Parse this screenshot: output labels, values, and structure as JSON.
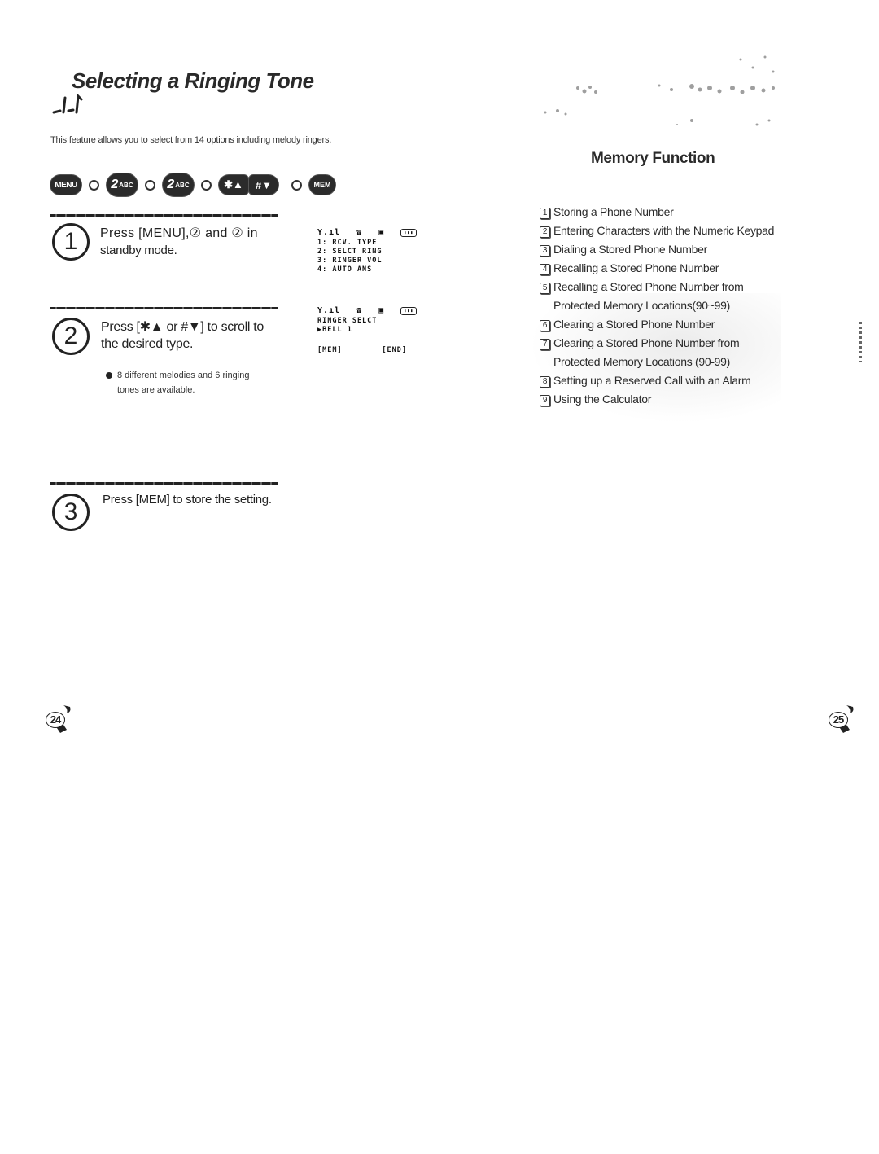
{
  "left_page": {
    "title": "Selecting a Ringing Tone",
    "intro": "This feature allows you to select from 14 options including melody ringers.",
    "key_sequence": [
      {
        "icon": "menu-key-icon",
        "label": "MENU"
      },
      {
        "icon": "two-abc-key-icon",
        "label": "2",
        "sub": "ABC"
      },
      {
        "icon": "two-abc-key-icon",
        "label": "2",
        "sub": "ABC"
      },
      {
        "icon": "star-up-key-icon",
        "label": "✱▲"
      },
      {
        "icon": "hash-down-key-icon",
        "label": "#▼"
      },
      {
        "icon": "mem-key-icon",
        "label": "MEM"
      }
    ],
    "steps": [
      {
        "number": "1",
        "text_line1": "Press [MENU],② and ② in",
        "text_line2": "standby mode.",
        "display": {
          "icons": [
            "signal-icon",
            "phone-icon",
            "d-icon",
            "battery-icon"
          ],
          "lines": [
            "1: RCV. TYPE",
            "2: SELCT RING",
            "3: RINGER VOL",
            "4: AUTO ANS"
          ]
        }
      },
      {
        "number": "2",
        "text_line1": "Press [✱▲ or #▼] to scroll to",
        "text_line2": "the desired type.",
        "note_line1": "8 different melodies and 6 ringing",
        "note_line2": "tones are available.",
        "display": {
          "icons": [
            "signal-icon",
            "phone-icon",
            "d-icon",
            "battery-icon"
          ],
          "lines": [
            "RINGER SELCT",
            "▶BELL 1"
          ],
          "softkey_left": "[MEM]",
          "softkey_right": "[END]"
        }
      },
      {
        "number": "3",
        "text_line1": "Press [MEM] to store the setting."
      }
    ],
    "page_number": "24"
  },
  "right_page": {
    "section_title": "Memory Function",
    "toc": [
      {
        "num": "1",
        "line1": "Storing a Phone Number"
      },
      {
        "num": "2",
        "line1": "Entering Characters with the Numeric Keypad"
      },
      {
        "num": "3",
        "line1": "Dialing a Stored Phone Number"
      },
      {
        "num": "4",
        "line1": "Recalling a Stored Phone Number"
      },
      {
        "num": "5",
        "line1": "Recalling a Stored Phone Number from",
        "line2": "Protected Memory Locations(90~99)"
      },
      {
        "num": "6",
        "line1": "Clearing a Stored Phone Number"
      },
      {
        "num": "7",
        "line1": "Clearing a Stored Phone Number from",
        "line2": "Protected Memory Locations (90-99)"
      },
      {
        "num": "8",
        "line1": "Setting up a Reserved Call with an Alarm"
      },
      {
        "num": "9",
        "line1": "Using the Calculator"
      }
    ],
    "page_number": "25"
  }
}
